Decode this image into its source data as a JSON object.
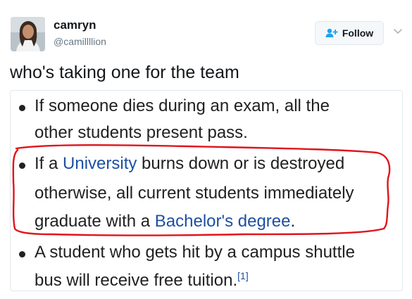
{
  "user": {
    "display_name": "camryn",
    "handle": "@camillllion"
  },
  "follow_button": {
    "label": "Follow"
  },
  "tweet": {
    "text": "who's taking one for the team"
  },
  "image": {
    "items": [
      {
        "lines": [
          {
            "text": "If someone dies during an exam, all the"
          },
          {
            "text": "other students present pass."
          }
        ]
      },
      {
        "lines": [
          {
            "pre": "If a ",
            "link": "University",
            "post": " burns down or is destroyed"
          },
          {
            "text": "otherwise, all current students immediately"
          },
          {
            "pre": "graduate with a ",
            "link": "Bachelor's degree",
            "post": "."
          }
        ]
      },
      {
        "lines": [
          {
            "text": "A student who gets hit by a campus shuttle"
          },
          {
            "text": "bus will receive free tuition.",
            "citation": "[1]"
          }
        ]
      }
    ]
  },
  "colors": {
    "link": "#1e4fa3",
    "highlight": "#e0141c",
    "follow_icon": "#1da1f2"
  },
  "icons": [
    "avatar",
    "add-user-icon",
    "chevron-down-icon"
  ]
}
